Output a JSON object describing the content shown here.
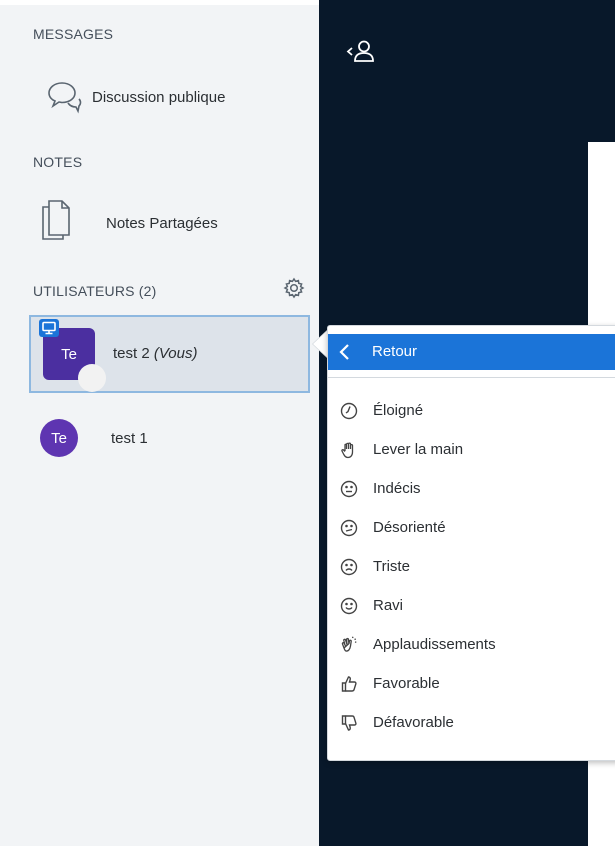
{
  "sidebar": {
    "messages_title": "MESSAGES",
    "public_chat_label": "Discussion publique",
    "notes_title": "NOTES",
    "shared_notes_label": "Notes Partagées",
    "users_title": "UTILISATEURS (2)"
  },
  "users": [
    {
      "initials": "Te",
      "name": "test 2",
      "you_tag": "(Vous)",
      "presenter": true,
      "selected": true
    },
    {
      "initials": "Te",
      "name": "test 1",
      "you_tag": "",
      "presenter": false,
      "selected": false
    }
  ],
  "status_menu": {
    "back_label": "Retour",
    "items": [
      {
        "icon": "clock-icon",
        "label": "Éloigné"
      },
      {
        "icon": "hand-icon",
        "label": "Lever la main"
      },
      {
        "icon": "neutral-face-icon",
        "label": "Indécis"
      },
      {
        "icon": "confused-face-icon",
        "label": "Désorienté"
      },
      {
        "icon": "sad-face-icon",
        "label": "Triste"
      },
      {
        "icon": "happy-face-icon",
        "label": "Ravi"
      },
      {
        "icon": "applause-icon",
        "label": "Applaudissements"
      },
      {
        "icon": "thumbs-up-icon",
        "label": "Favorable"
      },
      {
        "icon": "thumbs-down-icon",
        "label": "Défavorable"
      }
    ]
  },
  "colors": {
    "sidebar_bg": "#f2f4f6",
    "main_bg": "#08182a",
    "accent": "#1b74d8",
    "avatar_purple": "#4b2fa0"
  }
}
